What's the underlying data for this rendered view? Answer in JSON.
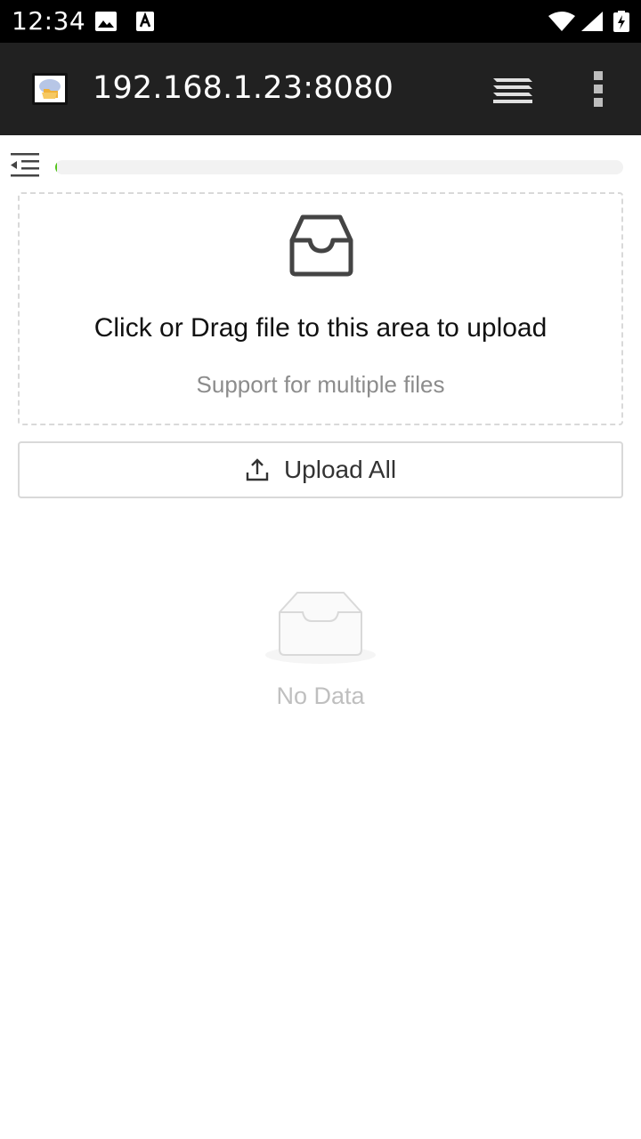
{
  "status_bar": {
    "time": "12:34",
    "icons": [
      "image-icon",
      "font-icon",
      "wifi-icon",
      "signal-icon",
      "battery-charging-icon"
    ]
  },
  "app_bar": {
    "title": "192.168.1.23:8080",
    "favicon": "cloud-folder-icon",
    "tabs_icon": "layers-icon",
    "menu_icon": "more-vertical-icon",
    "background": "#212121"
  },
  "toolbar": {
    "collapse_icon": "menu-collapse-icon",
    "progress_fraction": 0.003,
    "progress_color": "#52c41a"
  },
  "dropzone": {
    "icon": "inbox-icon",
    "text": "Click or Drag file to this area to upload",
    "hint": "Support for multiple files"
  },
  "upload_button": {
    "icon": "upload-icon",
    "label": "Upload All"
  },
  "empty_state": {
    "icon": "empty-box-icon",
    "text": "No Data"
  }
}
